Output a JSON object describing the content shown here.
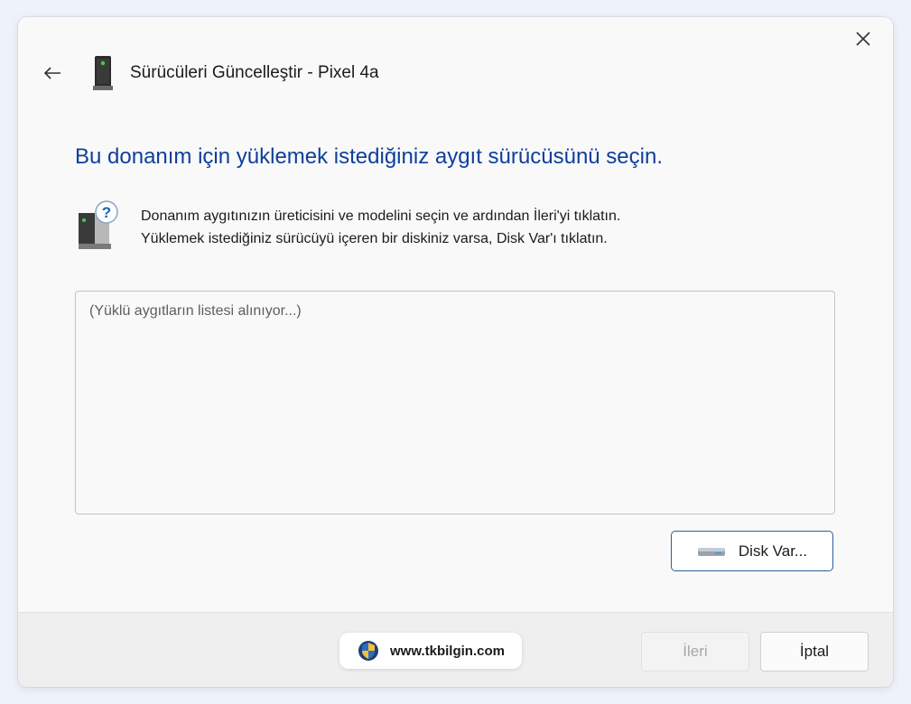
{
  "window": {
    "title": "Sürücüleri Güncelleştir - Pixel 4a"
  },
  "main": {
    "heading": "Bu donanım için yüklemek istediğiniz aygıt sürücüsünü seçin.",
    "instructions": [
      "Donanım aygıtınızın üreticisini ve modelini seçin ve ardından İleri'yi tıklatın.",
      "Yüklemek istediğiniz sürücüyü içeren bir diskiniz varsa, Disk Var'ı tıklatın."
    ],
    "device_list": {
      "status_text": "(Yüklü aygıtların listesi alınıyor...)"
    },
    "disk_button_label": "Disk Var..."
  },
  "footer": {
    "watermark_text": "www.tkbilgin.com",
    "next_label": "İleri",
    "next_enabled": false,
    "cancel_label": "İptal"
  },
  "icons": {
    "close": "close-icon",
    "back": "back-arrow-icon",
    "device": "phone-device-icon",
    "hardware": "hardware-question-icon",
    "disk": "disk-drive-icon",
    "shield": "shield-icon"
  },
  "colors": {
    "heading": "#0e3f9a",
    "accent_border": "#2f5e9c",
    "disabled_text": "#a6a6a6"
  }
}
